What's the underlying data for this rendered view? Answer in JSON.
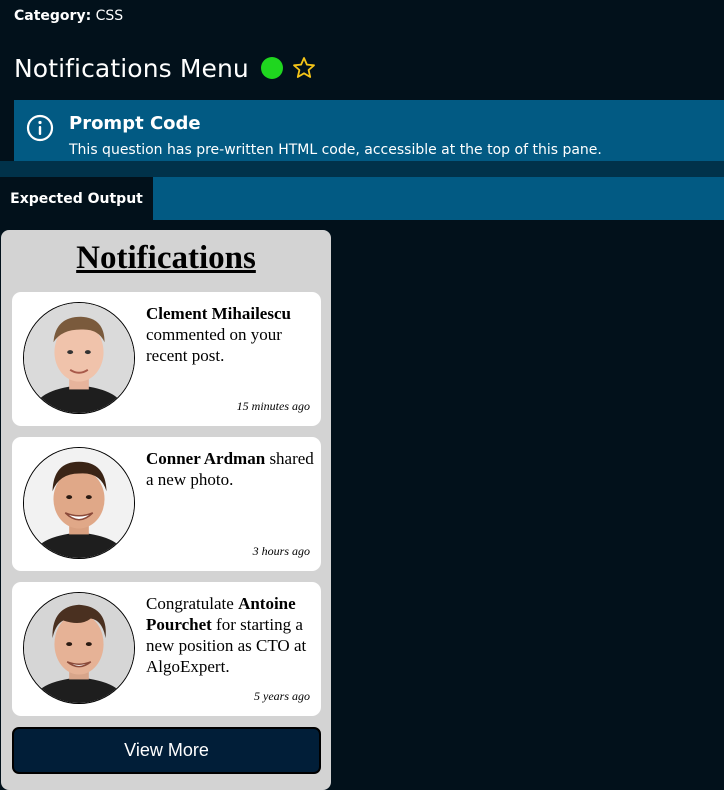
{
  "header": {
    "category_label": "Category:",
    "category_value": "CSS",
    "title": "Notifications Menu",
    "status_color": "#1fd61f",
    "star_color": "#f5c518",
    "star_icon": "star-outline-icon"
  },
  "prompt": {
    "icon": "info-icon",
    "heading": "Prompt Code",
    "text": "This question has pre-written HTML code, accessible at the top of this pane."
  },
  "tabs": {
    "active_label": "Expected Output"
  },
  "output": {
    "heading": "Notifications",
    "notifications": [
      {
        "name": "Clement Mihailescu",
        "message": "commented on your recent post.",
        "time": "15 minutes ago"
      },
      {
        "name": "Conner Ardman",
        "message": "shared a new photo.",
        "time": "3 hours ago"
      },
      {
        "prefix": "Congratulate",
        "name": "Antoine Pourchet",
        "message": "for starting a new position as CTO at AlgoExpert.",
        "time": "5 years ago"
      }
    ],
    "view_more_label": "View More"
  },
  "colors": {
    "background": "#02111b",
    "banner": "#025a83",
    "card_bg": "#d3d3d3",
    "button_bg": "#011e38"
  }
}
